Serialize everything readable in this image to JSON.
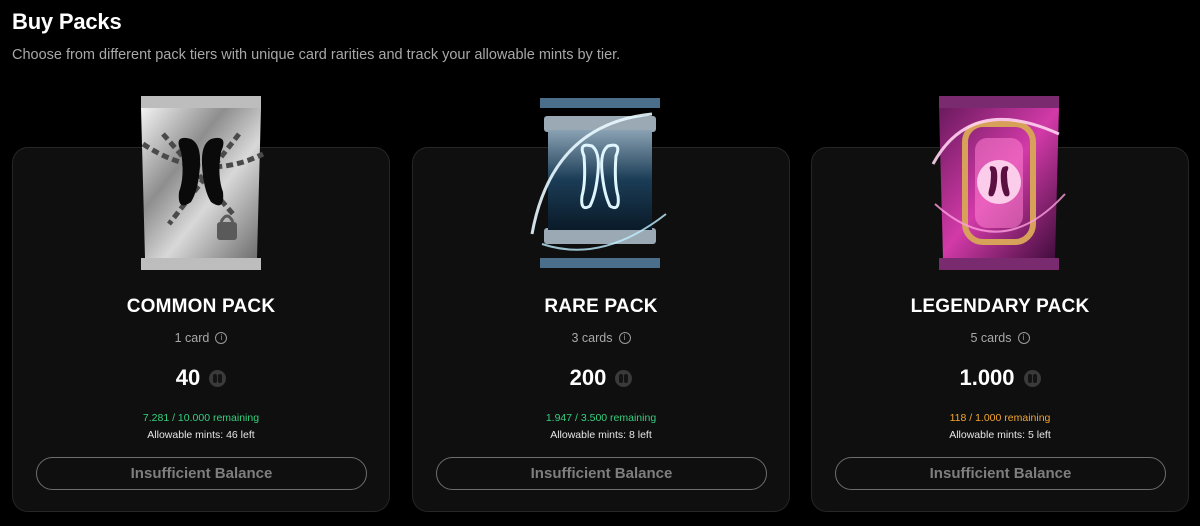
{
  "header": {
    "title": "Buy Packs",
    "subtitle": "Choose from different pack tiers with unique card rarities and track your allowable mints by tier."
  },
  "packs": [
    {
      "name": "COMMON PACK",
      "cards": "1 card",
      "price": "40",
      "remaining": "7.281 / 10.000 remaining",
      "mints": "Allowable mints: 46 left",
      "button": "Insufficient Balance",
      "accent": "#c9c9c9",
      "remaining_color": "#35d07f"
    },
    {
      "name": "RARE PACK",
      "cards": "3 cards",
      "price": "200",
      "remaining": "1.947 / 3.500 remaining",
      "mints": "Allowable mints: 8 left",
      "button": "Insufficient Balance",
      "accent": "#7fd4ff",
      "remaining_color": "#35d07f"
    },
    {
      "name": "LEGENDARY PACK",
      "cards": "5 cards",
      "price": "1.000",
      "remaining": "118 / 1.000 remaining",
      "mints": "Allowable mints: 5 left",
      "button": "Insufficient Balance",
      "accent": "#ff4fc8",
      "remaining_color": "#f2a531"
    }
  ],
  "icons": {
    "info": "info-icon",
    "coin": "coin-icon",
    "logo": "butterfly-logo-icon"
  }
}
